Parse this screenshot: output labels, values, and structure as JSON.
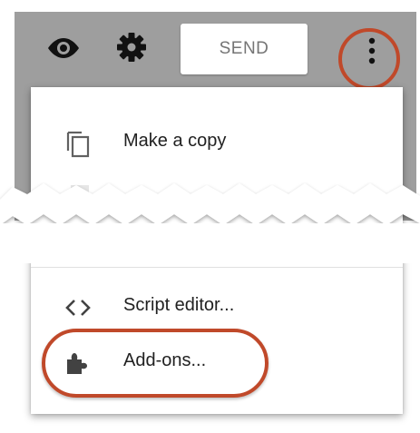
{
  "toolbar": {
    "preview_icon": "eye-icon",
    "settings_icon": "gear-icon",
    "send_label": "SEND",
    "more_icon": "more-vertical-icon",
    "background_color": "#9e9e9e"
  },
  "menu": {
    "items": [
      {
        "label": "Make a copy",
        "icon": "copy-icon"
      },
      {
        "label": "Script editor...",
        "icon": "code-brackets-icon"
      },
      {
        "label": "Add-ons...",
        "icon": "puzzle-piece-icon"
      }
    ]
  },
  "highlight_color": "#c0492a"
}
